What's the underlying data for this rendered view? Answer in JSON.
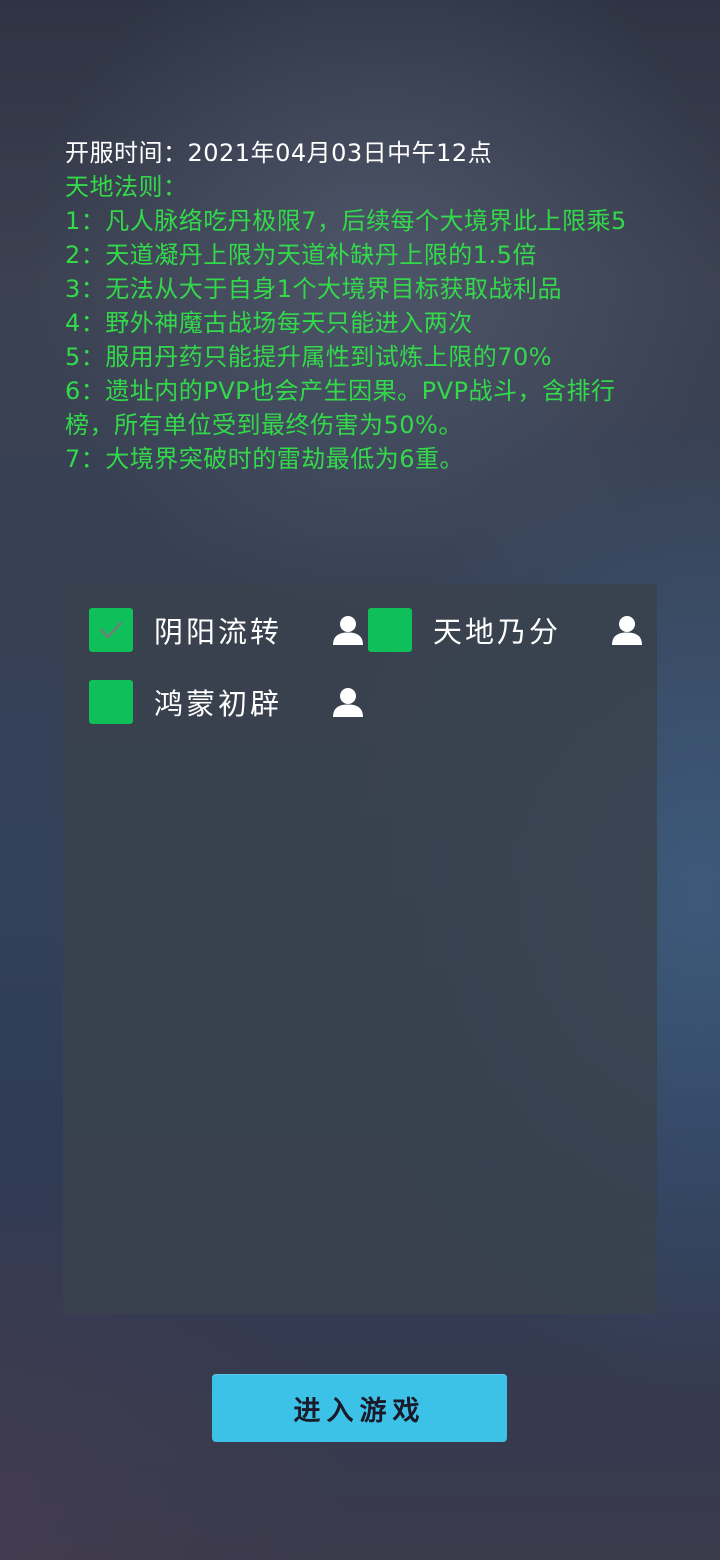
{
  "notice": {
    "open_time": "开服时间：2021年04月03日中午12点",
    "rules_title": "天地法则：",
    "rules": [
      "1：凡人脉络吃丹极限7，后续每个大境界此上限乘5",
      "2：天道凝丹上限为天道补缺丹上限的1.5倍",
      "3：无法从大于自身1个大境界目标获取战利品",
      "4：野外神魔古战场每天只能进入两次",
      "5：服用丹药只能提升属性到试炼上限的70%",
      "6：遗址内的PVP也会产生因果。PVP战斗，含排行榜，所有单位受到最终伤害为50%。",
      "7：大境界突破时的雷劫最低为6重。"
    ],
    "text_color": "#33d94a"
  },
  "servers": [
    {
      "name": "阴阳流转",
      "checked": true,
      "icon": "user-icon"
    },
    {
      "name": "天地乃分",
      "checked": false,
      "icon": "user-icon"
    },
    {
      "name": "鸿蒙初辟",
      "checked": false,
      "icon": "user-icon"
    }
  ],
  "enter_button": {
    "label": "进入游戏",
    "color": "#3cc2e6"
  },
  "colors": {
    "checkbox": "#0fbf5a",
    "panel": "#3a424c"
  }
}
